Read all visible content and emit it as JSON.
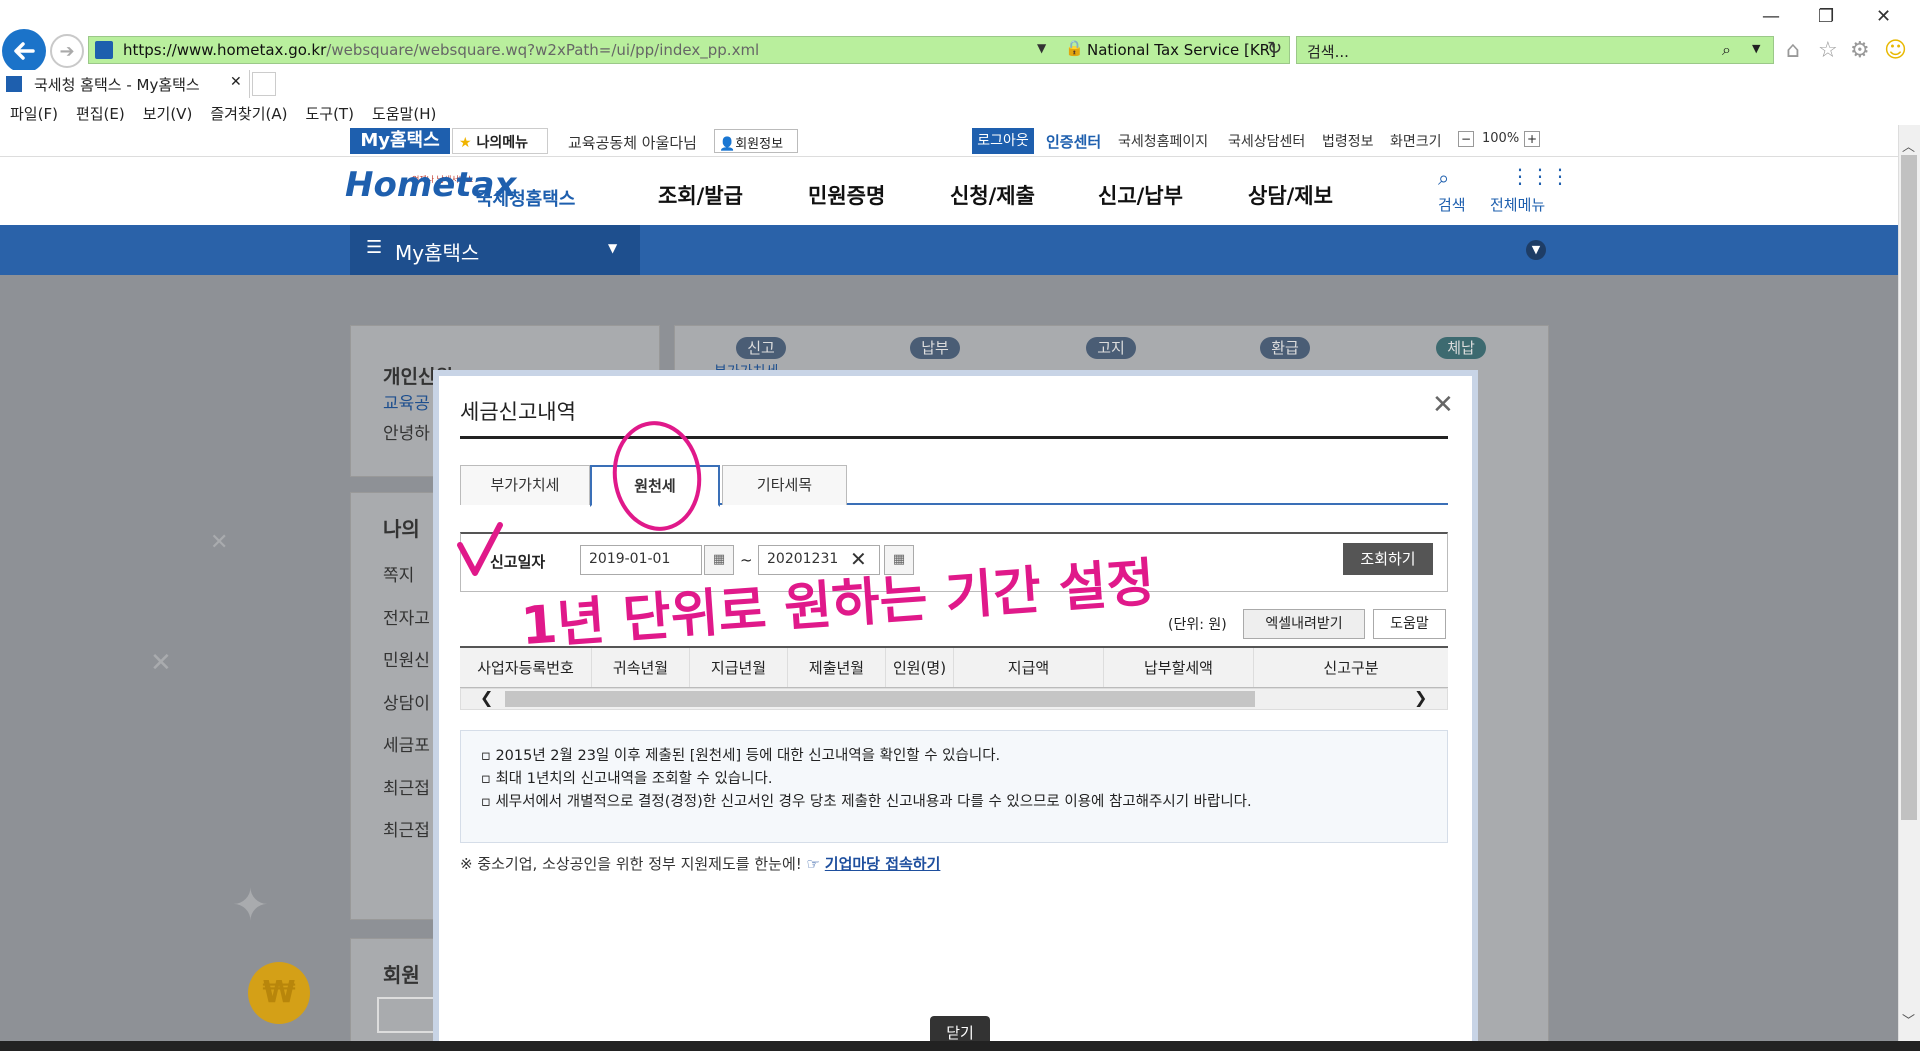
{
  "browser": {
    "url_host": "https://www.hometax.go.kr",
    "url_path": "/websquare/websquare.wq?w2xPath=/ui/pp/index_pp.xml",
    "site_identity": "National Tax Service [KR]",
    "search_placeholder": "검색...",
    "tab_title": "국세청 홈택스 - My홈택스",
    "menu": [
      "파일(F)",
      "편집(E)",
      "보기(V)",
      "즐겨찾기(A)",
      "도구(T)",
      "도움말(H)"
    ]
  },
  "site": {
    "my_hometax": "My홈택스",
    "my_menu": "나의메뉴",
    "user_greeting": "교육공동체 아울다님",
    "member_info": "회원정보",
    "logout": "로그아웃",
    "top_links": [
      "인증센터",
      "국세청홈페이지",
      "국세상담센터",
      "법령정보",
      "화면크기"
    ],
    "zoom": "100%",
    "logo": "Hometax",
    "logo_sub": "국세청홈택스",
    "logo_tag": "언제나 납세서비스",
    "gnav": [
      "조회/발급",
      "민원증명",
      "신청/제출",
      "신고/납부",
      "상담/제보"
    ],
    "search_label": "검색",
    "all_menu_label": "전체메뉴",
    "subnav_title": "My홈택스"
  },
  "background": {
    "panel1_title": "개인신원",
    "panel1_line1": "교육공",
    "panel1_line2": "안녕하",
    "panel2_title": "나의",
    "panel2_items": [
      "쪽지",
      "전자고",
      "민원신",
      "상담이",
      "세금포",
      "최근접",
      "최근접"
    ],
    "panel3_title": "회원",
    "right_tabs": [
      "신고",
      "납부",
      "고지",
      "환급",
      "체납"
    ],
    "right_tab_sub": "부가가치세"
  },
  "modal": {
    "title": "세금신고내역",
    "tabs": [
      "부가가치세",
      "원천세",
      "기타세목"
    ],
    "active_tab": "원천세",
    "date_label": "신고일자",
    "date_from": "2019-01-01",
    "date_sep": "~",
    "date_to": "20201231",
    "search_button": "조회하기",
    "unit": "(단위: 원)",
    "excel_button": "엑셀내려받기",
    "help_button": "도움말",
    "columns": [
      "사업자등록번호",
      "귀속년월",
      "지급년월",
      "제출년월",
      "인원(명)",
      "지급액",
      "납부할세액",
      "신고구분"
    ],
    "info": [
      "2015년 2월 23일 이후 제출된 [원천세] 등에 대한 신고내역을 확인할 수 있습니다.",
      "최대 1년치의 신고내역을 조회할 수 있습니다.",
      "세무서에서 개별적으로 결정(경정)한 신고서인 경우 당초 제출한 신고내용과 다를 수 있으므로 이용에 참고해주시기 바랍니다."
    ],
    "note_text": "※ 중소기업, 소상공인을 위한 정부 지원제도를 한눈에!",
    "note_link": "기업마당 접속하기",
    "close_button": "닫기"
  },
  "annotation": {
    "handwritten": "1년 단위로 원하는 기간 설정",
    "color": "#e0198a"
  }
}
